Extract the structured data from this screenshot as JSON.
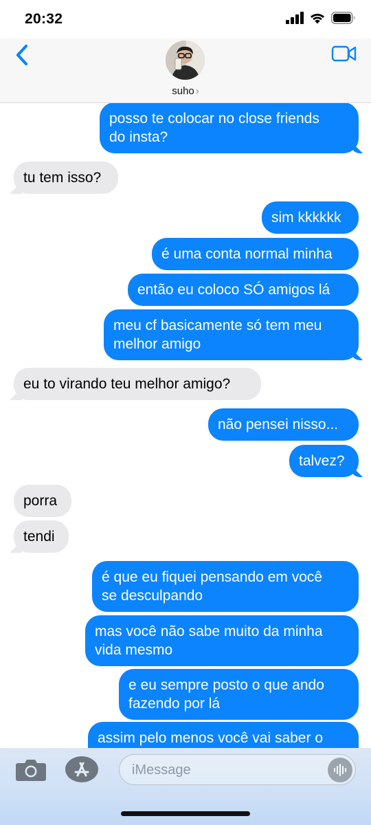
{
  "status": {
    "time": "20:32"
  },
  "header": {
    "contact_name": "suho",
    "chevron": "›"
  },
  "messages": [
    {
      "side": "sent",
      "text": "posso te colocar no close friends\ndo insta?"
    },
    {
      "side": "received",
      "text": "tu tem isso?"
    },
    {
      "side": "sent",
      "text": "sim kkkkkk"
    },
    {
      "side": "sent",
      "text": "é uma conta normal minha"
    },
    {
      "side": "sent",
      "text": "então eu coloco SÓ amigos lá"
    },
    {
      "side": "sent",
      "text": "meu cf basicamente só tem meu\nmelhor amigo"
    },
    {
      "side": "received",
      "text": "eu to virando teu melhor amigo?"
    },
    {
      "side": "sent",
      "text": "não pensei nisso..."
    },
    {
      "side": "sent",
      "text": "talvez?"
    },
    {
      "side": "received",
      "text": "porra"
    },
    {
      "side": "received",
      "text": "tendi"
    },
    {
      "side": "sent",
      "text": "é que eu fiquei pensando em você\nse desculpando"
    },
    {
      "side": "sent",
      "text": "mas você não sabe muito da minha\nvida mesmo"
    },
    {
      "side": "sent",
      "text": "e eu sempre posto o que ando\nfazendo por lá"
    },
    {
      "side": "sent",
      "text": "assim pelo menos você vai saber o"
    }
  ],
  "composer": {
    "placeholder": "iMessage"
  },
  "colors": {
    "sent_bubble": "#0b84fe",
    "received_bubble": "#e9e9eb",
    "accent": "#0b84fe"
  },
  "icons": {
    "back": "chevron-left-icon",
    "video": "video-camera-icon",
    "camera": "camera-icon",
    "apps": "app-store-icon",
    "audio": "waveform-icon"
  }
}
